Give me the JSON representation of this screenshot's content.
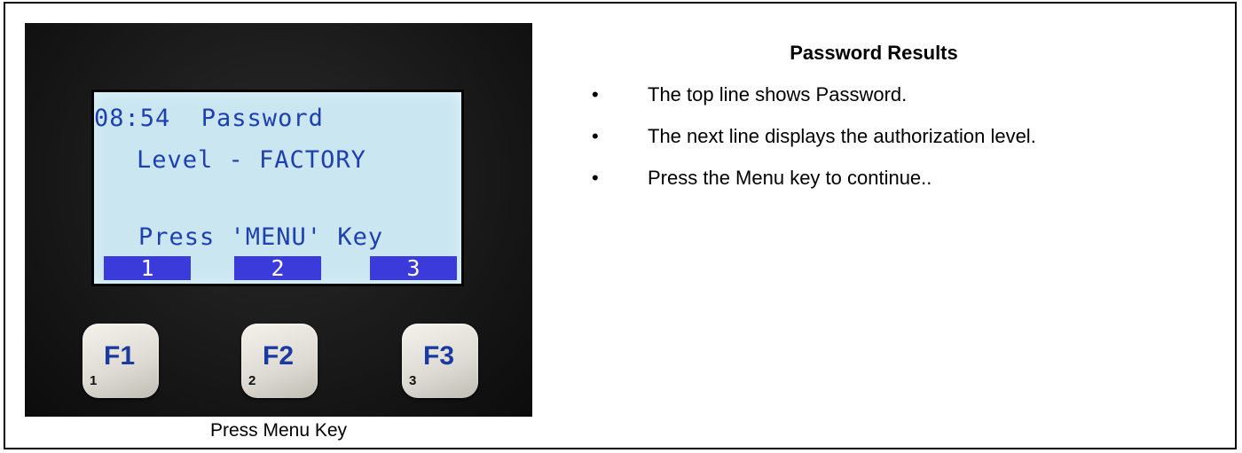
{
  "panel": {
    "title": "Password Results",
    "bullets": [
      "The top line shows Password.",
      "The next line displays the authorization level.",
      "Press the Menu key to continue.."
    ],
    "bullet_glyph": "•"
  },
  "device": {
    "lcd": {
      "top_line": "08:54  Password",
      "level_line": "Level - FACTORY",
      "prompt_line": "Press 'MENU' Key",
      "softkeys": [
        "1",
        "2",
        "3"
      ],
      "text_color": "#1f3fae",
      "background_color": "#c9e6f1",
      "softkey_color": "#3b3bdc"
    },
    "function_keys": [
      {
        "label": "F1",
        "number": "1"
      },
      {
        "label": "F2",
        "number": "2"
      },
      {
        "label": "F3",
        "number": "3"
      }
    ]
  },
  "caption": "Press Menu Key"
}
